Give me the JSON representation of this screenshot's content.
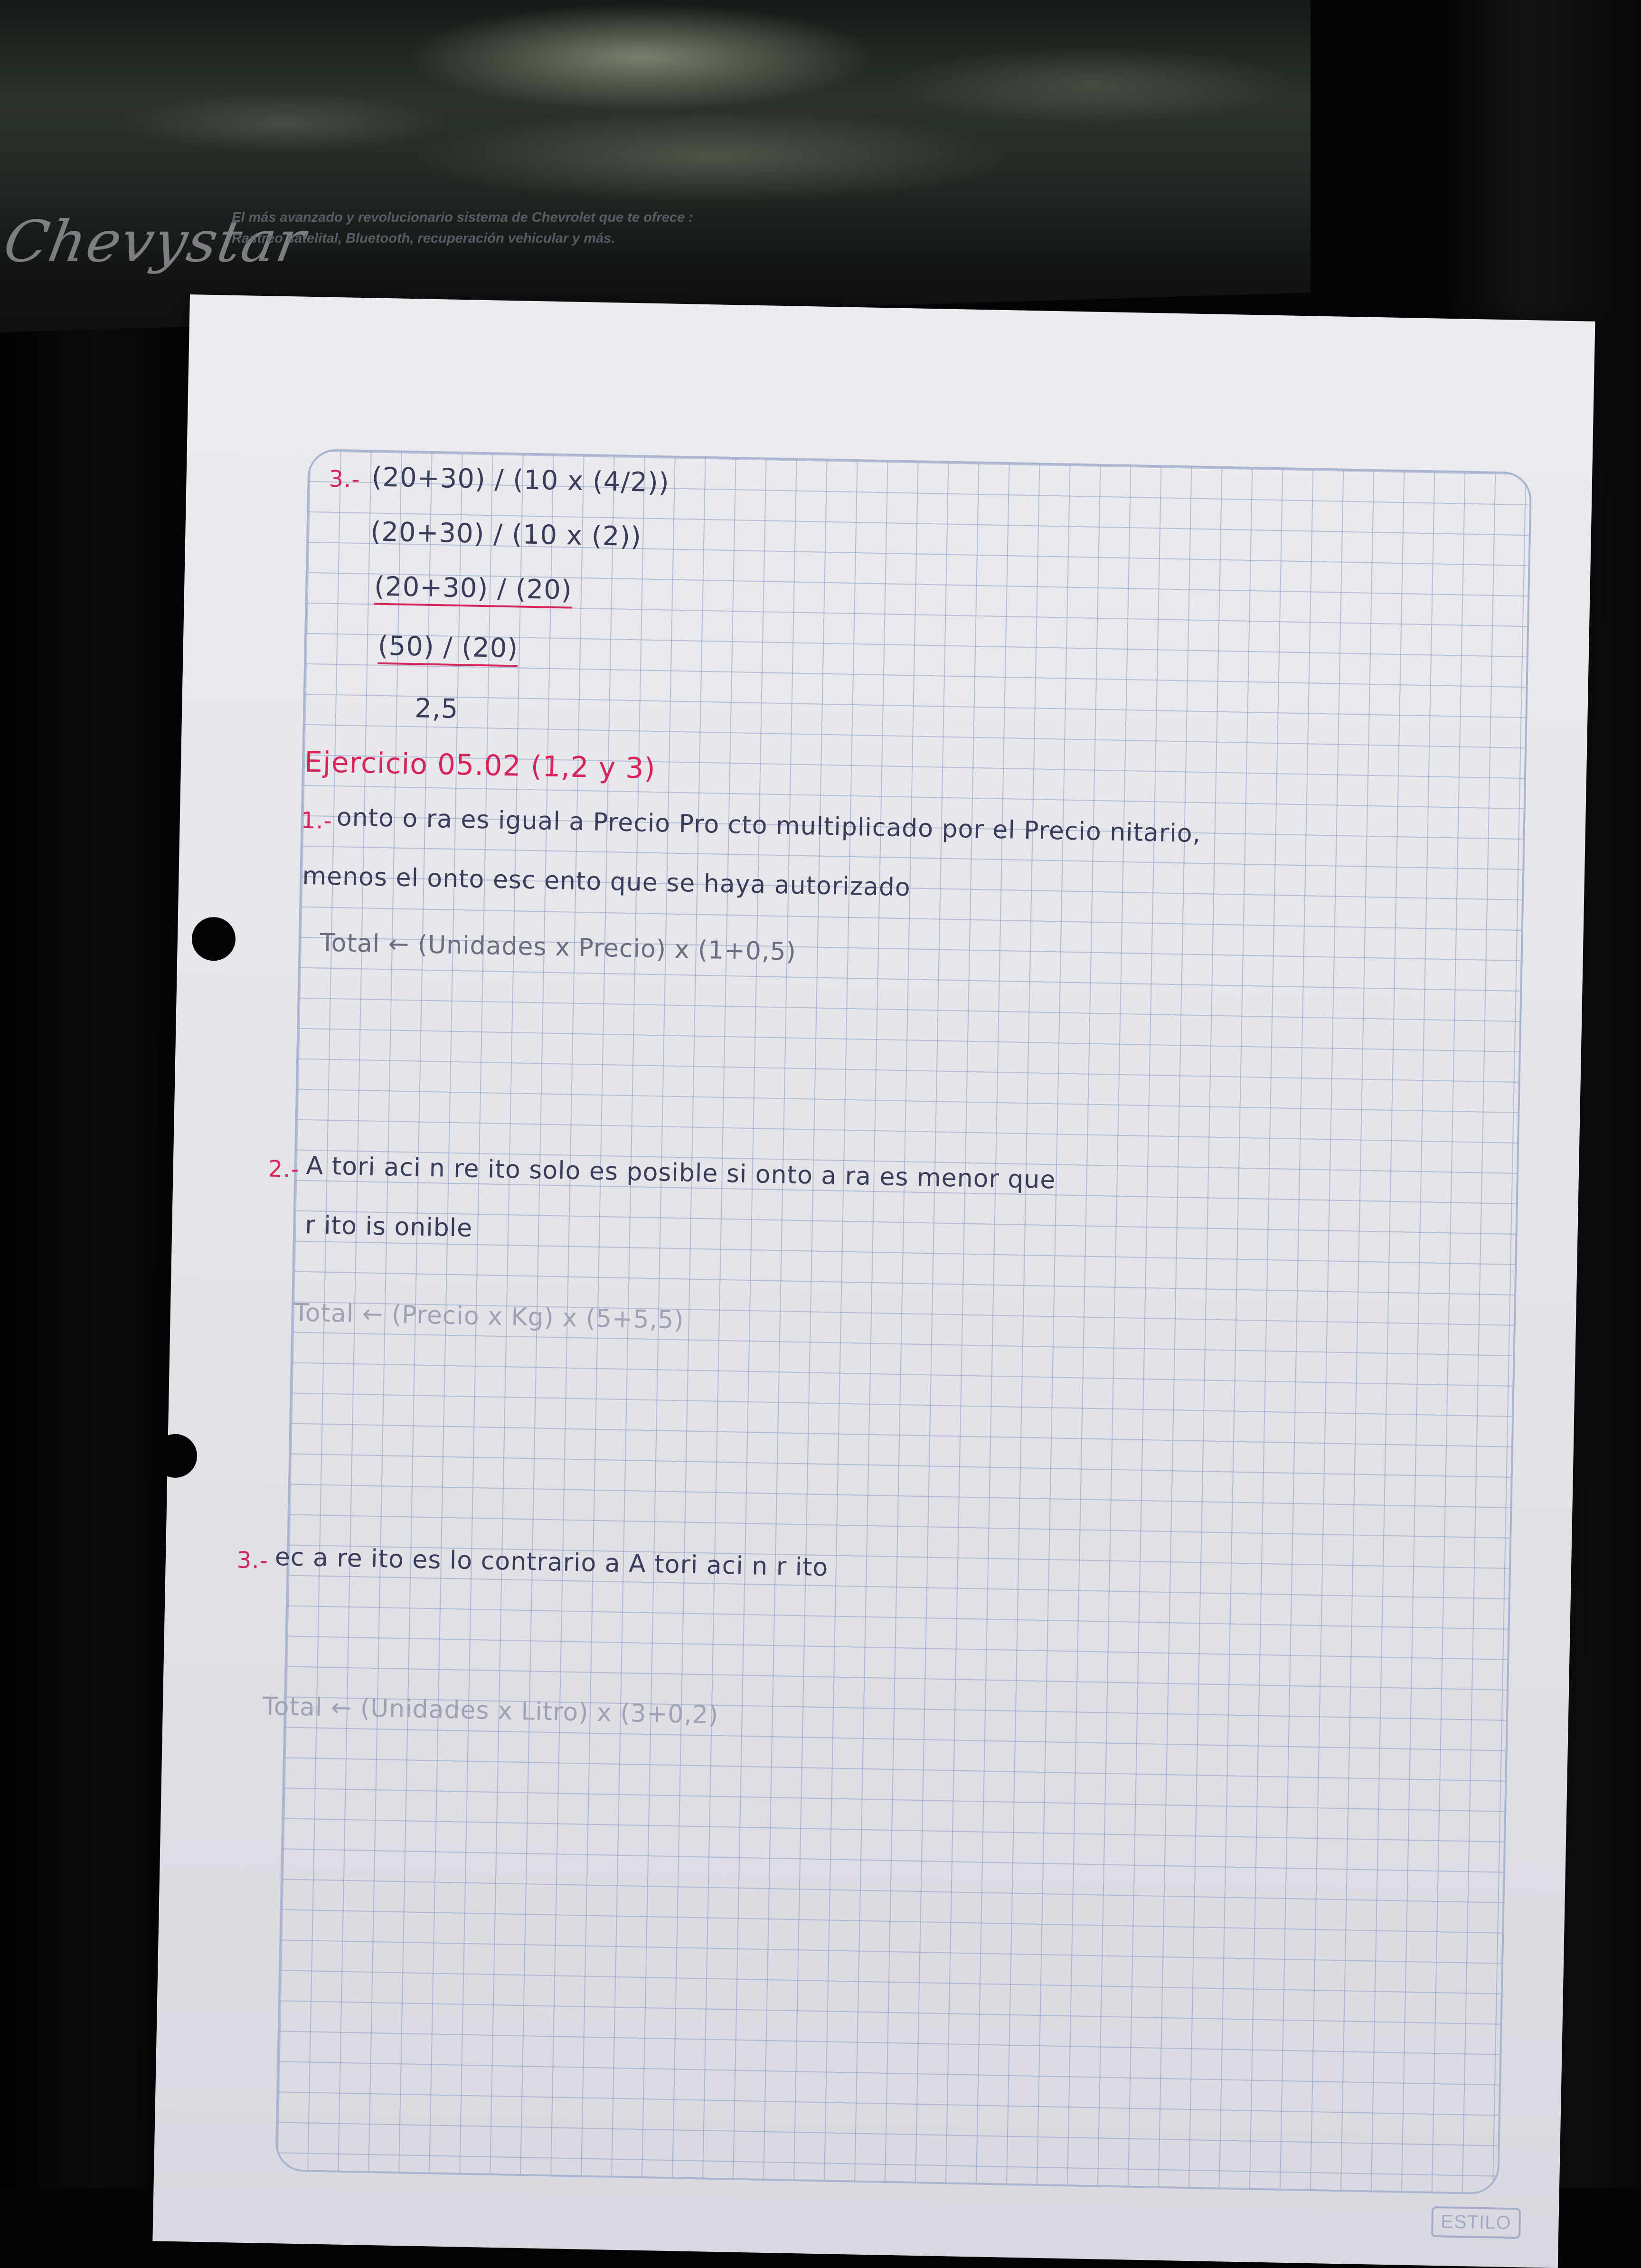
{
  "banner": {
    "logo": "Chevystar",
    "line1": "El más avanzado y revolucionario sistema de Chevrolet que te ofrece :",
    "line2": "Rastreo satelital, Bluetooth, recuperación vehicular y más."
  },
  "notebook": {
    "brand": "ESTILO",
    "exercise3_steps": {
      "label": "3.-",
      "step1": "(20+30) / (10 x (4/2))",
      "step2": "(20+30) / (10 x (2))",
      "step3": "(20+30) / (20)",
      "step4": "(50) / (20)",
      "result": "2,5"
    },
    "exercise_title": "Ejercicio 05.02 (1,2 y 3)",
    "item1": {
      "label": "1.-",
      "line1": "onto o ra es igual a Precio Pro cto multiplicado por el Precio nitario,",
      "line2": "menos el onto esc ento que se haya autorizado",
      "formula": "Total ← (Unidades x Precio) x (1+0,5)"
    },
    "item2": {
      "label": "2.-",
      "line1": "A tori aci n re ito solo es posible si onto a ra es menor que",
      "line2": "r ito is onible",
      "formula": "Total ← (Precio x Kg) x (5+5,5)"
    },
    "item3": {
      "label": "3.-",
      "line1": "ec a re ito es lo contrario a A tori aci n r ito",
      "formula": "Total ← (Unidades x Litro) x (3+0,2)"
    }
  }
}
